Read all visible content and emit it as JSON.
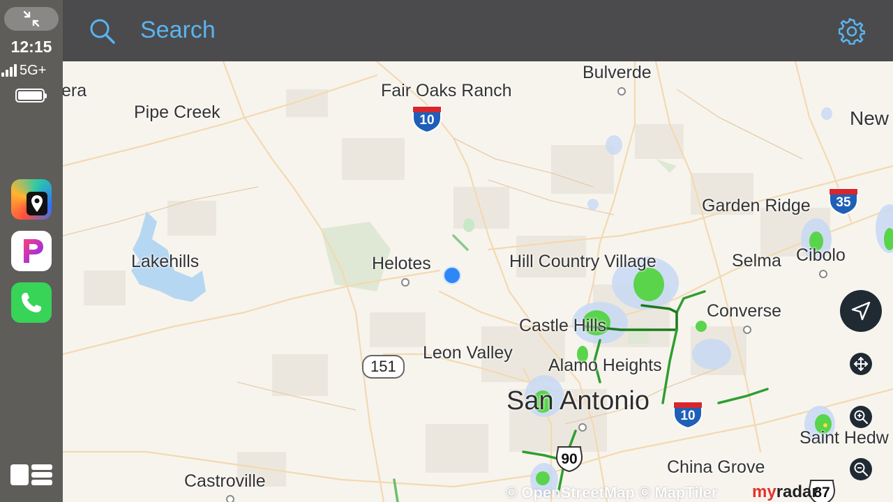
{
  "status": {
    "time": "12:15",
    "network": "5G+"
  },
  "apps": [
    {
      "name": "MyRadar"
    },
    {
      "name": "P app"
    },
    {
      "name": "Phone"
    }
  ],
  "search": {
    "placeholder": "Search"
  },
  "map": {
    "places": {
      "bulverde": "Bulverde",
      "fair_oaks_ranch": "Fair Oaks Ranch",
      "era": "era",
      "pipe_creek": "Pipe Creek",
      "new": "New",
      "garden_ridge": "Garden Ridge",
      "cibolo": "Cibolo",
      "lakehills": "Lakehills",
      "helotes": "Helotes",
      "hill_country_village": "Hill Country Village",
      "selma": "Selma",
      "converse": "Converse",
      "castle_hills": "Castle Hills",
      "leon_valley": "Leon Valley",
      "alamo_heights": "Alamo Heights",
      "san_antonio": "San Antonio",
      "saint_hedw": "Saint Hedw",
      "china_grove": "China Grove",
      "castroville": "Castroville"
    },
    "shields": {
      "i10_north": "10",
      "i35": "35",
      "i10_east": "10",
      "sh151": "151",
      "us90": "90",
      "us87": "87"
    },
    "attribution": "© OpenStreetMap © MapTiler",
    "brand_a": "my",
    "brand_b": "radar"
  },
  "colors": {
    "accent": "#5ab4f0",
    "radar_green": "#4fd34a",
    "location": "#2f86f6",
    "header": "#4b4b4d",
    "rail": "#5f5d5a"
  }
}
